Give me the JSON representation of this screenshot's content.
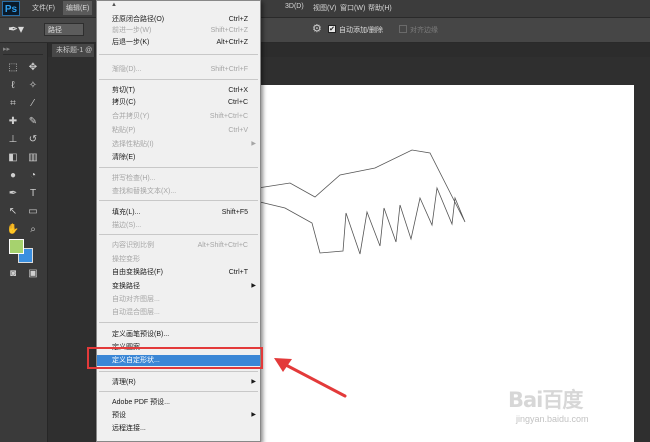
{
  "app": {
    "logo": "Ps"
  },
  "menubar": {
    "items": [
      {
        "label": "文件(F)",
        "active": false
      },
      {
        "label": "编辑(E)",
        "active": true
      },
      {
        "label": "3D(D)",
        "active": false
      },
      {
        "label": "视图(V)",
        "active": false
      },
      {
        "label": "窗口(W)",
        "active": false
      },
      {
        "label": "帮助(H)",
        "active": false
      }
    ]
  },
  "options_bar": {
    "mode_select": "路径",
    "auto_add_delete_label": "自动添加/删除",
    "auto_add_delete_checked": true,
    "align_edges_label": "对齐边缘",
    "align_edges_checked": false,
    "icons": [
      "pen-tool-icon",
      "gear-icon"
    ]
  },
  "document_tab": {
    "title": "未标题-1 @"
  },
  "edit_menu": {
    "top_arrow": "▲",
    "items": [
      {
        "label": "还原闭合路径(O)",
        "shortcut": "Ctrl+Z",
        "disabled": false
      },
      {
        "label": "前进一步(W)",
        "shortcut": "Shift+Ctrl+Z",
        "disabled": true
      },
      {
        "label": "后退一步(K)",
        "shortcut": "Alt+Ctrl+Z",
        "disabled": false
      },
      {
        "label": "渐隐(D)...",
        "shortcut": "Shift+Ctrl+F",
        "disabled": true
      },
      {
        "label": "剪切(T)",
        "shortcut": "Ctrl+X",
        "disabled": false
      },
      {
        "label": "拷贝(C)",
        "shortcut": "Ctrl+C",
        "disabled": false
      },
      {
        "label": "合并拷贝(Y)",
        "shortcut": "Shift+Ctrl+C",
        "disabled": true
      },
      {
        "label": "粘贴(P)",
        "shortcut": "Ctrl+V",
        "disabled": true
      },
      {
        "label": "选择性粘贴(I)",
        "shortcut": "",
        "disabled": true,
        "submenu": true
      },
      {
        "label": "清除(E)",
        "shortcut": "",
        "disabled": false
      },
      {
        "label": "拼写检查(H)...",
        "shortcut": "",
        "disabled": true
      },
      {
        "label": "查找和替换文本(X)...",
        "shortcut": "",
        "disabled": true
      },
      {
        "label": "填充(L)...",
        "shortcut": "Shift+F5",
        "disabled": false
      },
      {
        "label": "描边(S)...",
        "shortcut": "",
        "disabled": true
      },
      {
        "label": "内容识别比例",
        "shortcut": "Alt+Shift+Ctrl+C",
        "disabled": true
      },
      {
        "label": "操控变形",
        "shortcut": "",
        "disabled": true
      },
      {
        "label": "自由变换路径(F)",
        "shortcut": "Ctrl+T",
        "disabled": false
      },
      {
        "label": "变换路径",
        "shortcut": "",
        "disabled": false,
        "submenu": true
      },
      {
        "label": "自动对齐图层...",
        "shortcut": "",
        "disabled": true
      },
      {
        "label": "自动混合图层...",
        "shortcut": "",
        "disabled": true
      },
      {
        "label": "定义画笔预设(B)...",
        "shortcut": "",
        "disabled": false
      },
      {
        "label": "定义图案...",
        "shortcut": "",
        "disabled": false
      },
      {
        "label": "定义自定形状...",
        "shortcut": "",
        "disabled": false,
        "highlight": true
      },
      {
        "label": "清理(R)",
        "shortcut": "",
        "disabled": false,
        "submenu": true
      },
      {
        "label": "Adobe PDF 预设...",
        "shortcut": "",
        "disabled": false
      },
      {
        "label": "预设",
        "shortcut": "",
        "disabled": false,
        "submenu": true
      },
      {
        "label": "远程连接...",
        "shortcut": "",
        "disabled": false
      }
    ]
  },
  "toolbox": {
    "foreground_color": "#a6d26e",
    "background_color": "#3a8fe0",
    "tools": [
      "marquee-icon",
      "move-icon",
      "lasso-icon",
      "magic-wand-icon",
      "crop-icon",
      "eyedropper-icon",
      "healing-brush-icon",
      "brush-icon",
      "clone-stamp-icon",
      "history-brush-icon",
      "eraser-icon",
      "gradient-icon",
      "blur-icon",
      "dodge-icon",
      "pen-icon",
      "type-icon",
      "path-select-icon",
      "shape-icon",
      "hand-icon",
      "zoom-icon"
    ]
  },
  "watermark": {
    "main": "Bai百度",
    "sub": "jingyan.baidu.com"
  },
  "colors": {
    "highlight": "#3b87d6",
    "annotation_red": "#e33a3a"
  }
}
